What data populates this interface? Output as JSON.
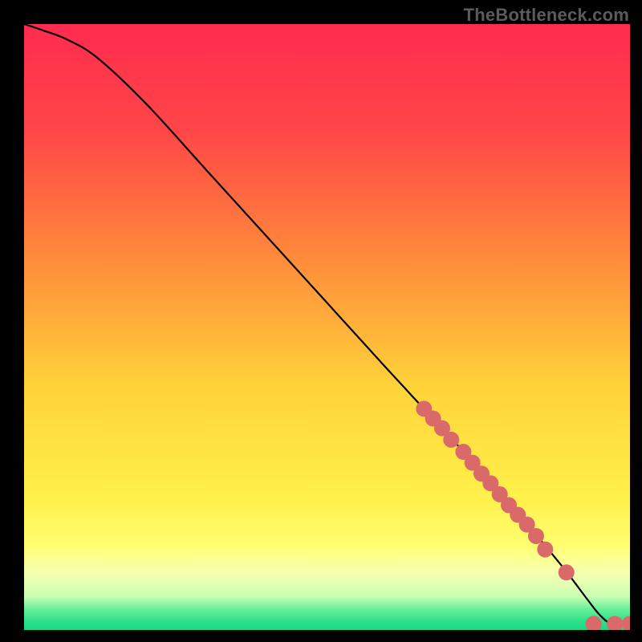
{
  "watermark": "TheBottleneck.com",
  "chart_data": {
    "type": "line",
    "title": "",
    "xlabel": "",
    "ylabel": "",
    "xlim": [
      0,
      100
    ],
    "ylim": [
      0,
      100
    ],
    "gradient_stops": [
      {
        "offset": 0.0,
        "color": "#ff2b4f"
      },
      {
        "offset": 0.18,
        "color": "#ff4747"
      },
      {
        "offset": 0.4,
        "color": "#ff8f3a"
      },
      {
        "offset": 0.6,
        "color": "#ffd33a"
      },
      {
        "offset": 0.78,
        "color": "#fff04a"
      },
      {
        "offset": 0.86,
        "color": "#ffff70"
      },
      {
        "offset": 0.905,
        "color": "#f7ffb0"
      },
      {
        "offset": 0.945,
        "color": "#c8ffb4"
      },
      {
        "offset": 0.965,
        "color": "#6af09a"
      },
      {
        "offset": 0.985,
        "color": "#2fe08c"
      },
      {
        "offset": 1.0,
        "color": "#18d884"
      }
    ],
    "curve": {
      "x": [
        0,
        3,
        7,
        12,
        20,
        30,
        40,
        50,
        60,
        66,
        72,
        78,
        83,
        88,
        90,
        93,
        95,
        97,
        100
      ],
      "y": [
        100,
        99,
        97.5,
        94.5,
        87,
        76,
        65,
        54,
        43,
        36.5,
        30,
        23,
        17.5,
        11.5,
        9,
        5,
        2.5,
        1,
        1
      ]
    },
    "points": {
      "x": [
        66,
        67.5,
        69,
        70.5,
        72.5,
        74,
        75.5,
        77,
        78.5,
        80,
        81.5,
        83,
        84.5,
        86,
        89.5,
        94,
        97.5,
        100
      ],
      "y": [
        36.5,
        34.9,
        33.3,
        31.4,
        29.4,
        27.6,
        25.8,
        24.2,
        22.4,
        20.6,
        19.0,
        17.4,
        15.5,
        13.3,
        9.5,
        1.0,
        1.0,
        1.0
      ]
    },
    "point_style": {
      "color": "#da6a6a",
      "radius": 10
    }
  }
}
